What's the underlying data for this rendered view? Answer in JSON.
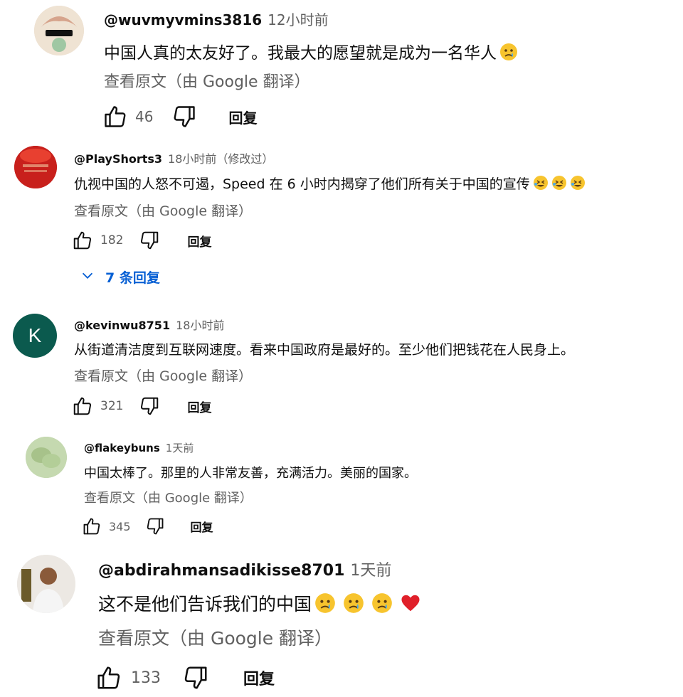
{
  "comments": [
    {
      "author": "@wuvmyvmins3816",
      "time": "12小时前",
      "text": "中国人真的太友好了。我最大的愿望就是成为一名华人",
      "translate": "查看原文（由 Google 翻译）",
      "likes": "46",
      "reply_label": "回复",
      "emojis": [
        "sad"
      ]
    },
    {
      "author": "@PlayShorts3",
      "time": "18小时前（修改过）",
      "text": "仇视中国的人怒不可遏，Speed 在 6 小时内揭穿了他们所有关于中国的宣传",
      "translate": "查看原文（由 Google 翻译）",
      "likes": "182",
      "reply_label": "回复",
      "emojis": [
        "rofl",
        "rofl",
        "rofl"
      ],
      "replies_label": "7 条回复"
    },
    {
      "author": "@kevinwu8751",
      "time": "18小时前",
      "avatar_letter": "K",
      "text": "从街道清洁度到互联网速度。看来中国政府是最好的。至少他们把钱花在人民身上。",
      "translate": "查看原文（由 Google 翻译）",
      "likes": "321",
      "reply_label": "回复",
      "emojis": []
    },
    {
      "author": "@flakeybuns",
      "time": "1天前",
      "text": "中国太棒了。那里的人非常友善，充满活力。美丽的国家。",
      "translate": "查看原文（由 Google 翻译）",
      "likes": "345",
      "reply_label": "回复",
      "emojis": []
    },
    {
      "author": "@abdirahmansadikisse8701",
      "time": "1天前",
      "text": "这不是他们告诉我们的中国",
      "translate": "查看原文（由 Google 翻译）",
      "likes": "133",
      "reply_label": "回复",
      "emojis": [
        "sad",
        "sad",
        "sad",
        "heart"
      ]
    }
  ],
  "colors": {
    "link": "#065fd4",
    "secondary": "#606060",
    "avatar_k": "#0b5a4e"
  }
}
